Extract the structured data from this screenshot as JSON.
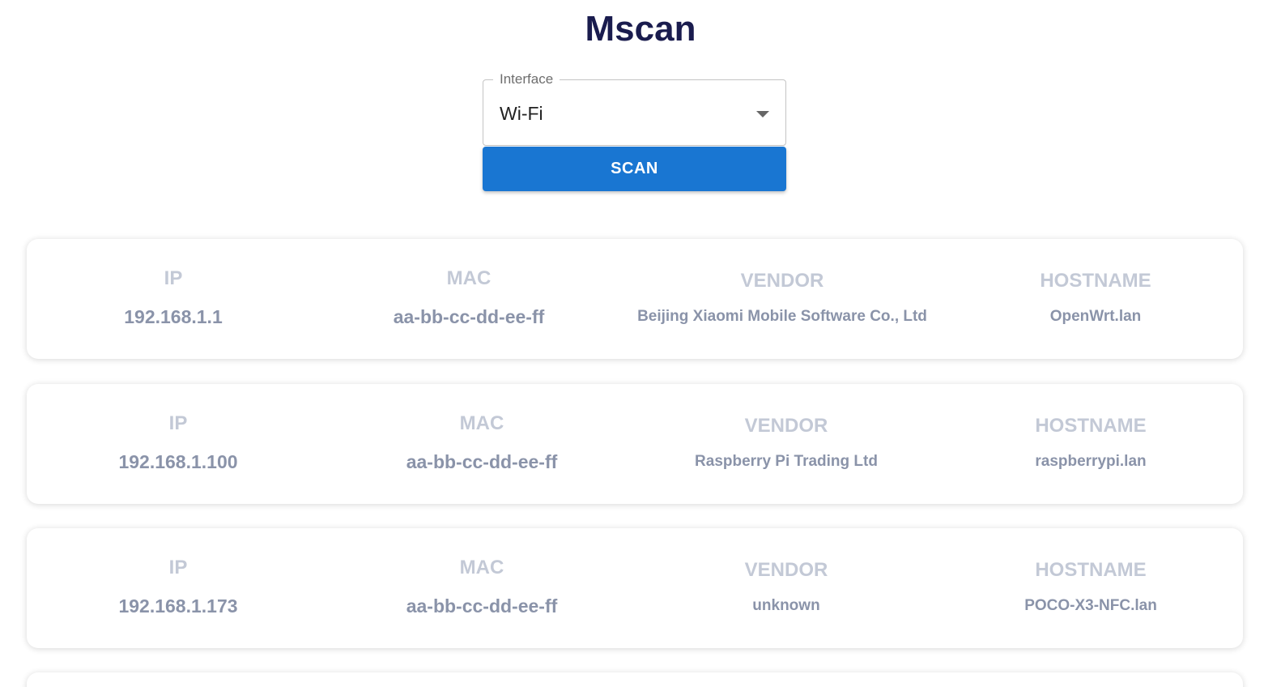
{
  "app": {
    "title": "Mscan"
  },
  "interface_select": {
    "label": "Interface",
    "value": "Wi-Fi"
  },
  "scan_button": {
    "label": "SCAN"
  },
  "columns": {
    "ip": "IP",
    "mac": "MAC",
    "vendor": "VENDOR",
    "hostname": "HOSTNAME"
  },
  "devices": [
    {
      "ip": "192.168.1.1",
      "mac": "aa-bb-cc-dd-ee-ff",
      "vendor": "Beijing Xiaomi Mobile Software Co., Ltd",
      "hostname": "OpenWrt.lan"
    },
    {
      "ip": "192.168.1.100",
      "mac": "aa-bb-cc-dd-ee-ff",
      "vendor": "Raspberry Pi Trading Ltd",
      "hostname": "raspberrypi.lan"
    },
    {
      "ip": "192.168.1.173",
      "mac": "aa-bb-cc-dd-ee-ff",
      "vendor": "unknown",
      "hostname": "POCO-X3-NFC.lan"
    }
  ],
  "colors": {
    "title": "#1a1c4e",
    "button": "#1976d2",
    "label": "#c3c9d6",
    "value": "#8a93a9"
  }
}
